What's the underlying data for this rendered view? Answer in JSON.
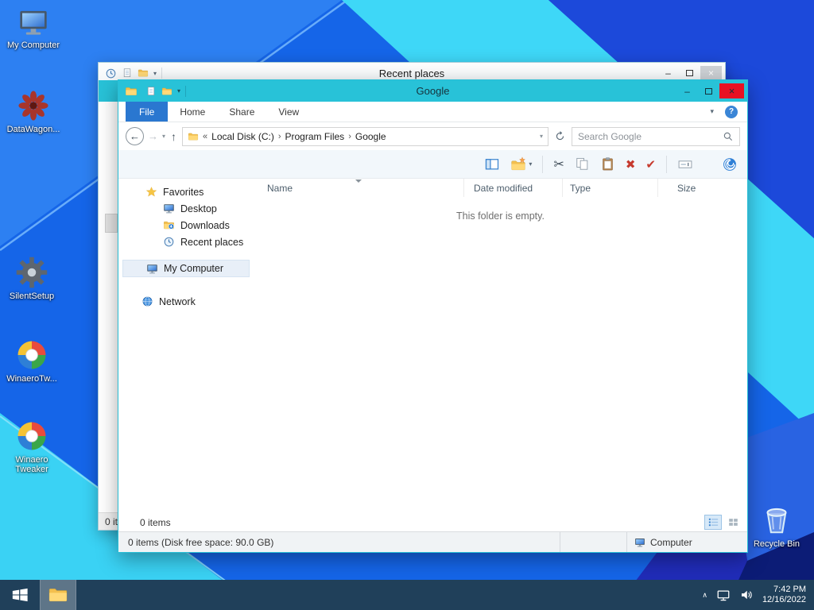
{
  "colors": {
    "titlebar_cyan": "#28c2d8",
    "close_red": "#e81123",
    "file_tab_blue": "#2a77d0",
    "taskbar": "#20405a"
  },
  "icons": {
    "back_arrow": "←",
    "forward_arrow": "→",
    "up_arrow": "↑",
    "dropdown": "▾",
    "minimize": "–",
    "close": "×",
    "help": "?",
    "scissors": "✂",
    "delete": "✖",
    "confirm": "✔",
    "tray_chevron": "∧",
    "crumb_chevron": "›"
  },
  "desktop": {
    "icons": [
      {
        "label": "My Computer"
      },
      {
        "label": "DataWagon..."
      },
      {
        "label": "SilentSetup"
      },
      {
        "label": "WinaeroTw..."
      },
      {
        "label": "Winaero Tweaker"
      },
      {
        "label": "Recycle Bin"
      }
    ]
  },
  "back_window": {
    "title": "Recent places",
    "status_text": "0 it"
  },
  "front_window": {
    "title": "Google",
    "ribbon_tabs": [
      {
        "label": "File"
      },
      {
        "label": "Home"
      },
      {
        "label": "Share"
      },
      {
        "label": "View"
      }
    ],
    "address": {
      "prefix": "«",
      "crumbs": [
        "Local Disk (C:)",
        "Program Files",
        "Google"
      ]
    },
    "search_placeholder": "Search Google",
    "nav": {
      "sections": [
        {
          "label": "Favorites",
          "items": [
            "Desktop",
            "Downloads",
            "Recent places"
          ]
        },
        {
          "label": "My Computer",
          "items": []
        },
        {
          "label": "Network",
          "items": []
        }
      ]
    },
    "columns": [
      "Name",
      "Date modified",
      "Type",
      "Size"
    ],
    "empty_text": "This folder is empty.",
    "items_status": "0 items",
    "statusbar": {
      "left": "0 items (Disk free space: 90.0 GB)",
      "computer": "Computer"
    }
  },
  "taskbar": {
    "clock": {
      "time": "7:42 PM",
      "date": "12/16/2022"
    }
  }
}
